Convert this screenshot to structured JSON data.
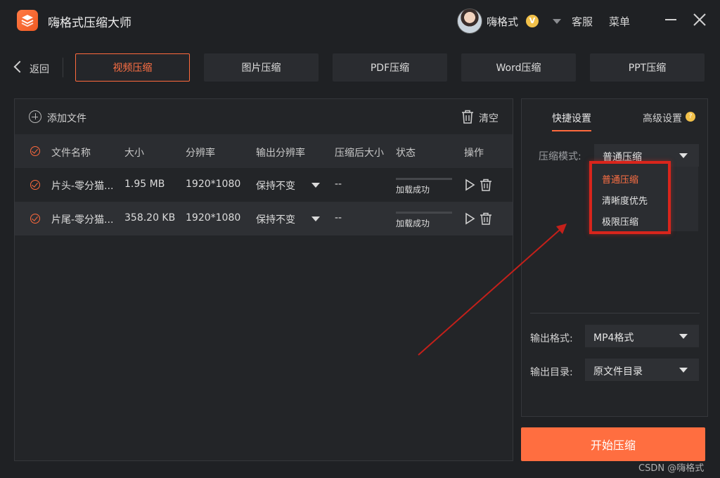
{
  "app": {
    "title": "嗨格式压缩大师"
  },
  "header": {
    "user_name": "嗨格式",
    "vip_badge": "V",
    "service_label": "客服",
    "menu_label": "菜单"
  },
  "nav": {
    "back_label": "返回",
    "tabs": [
      {
        "label": "视频压缩",
        "active": true
      },
      {
        "label": "图片压缩",
        "active": false
      },
      {
        "label": "PDF压缩",
        "active": false
      },
      {
        "label": "Word压缩",
        "active": false
      },
      {
        "label": "PPT压缩",
        "active": false
      }
    ]
  },
  "file_panel": {
    "add_file_label": "添加文件",
    "clear_label": "清空",
    "columns": [
      "文件名称",
      "大小",
      "分辨率",
      "输出分辨率",
      "压缩后大小",
      "状态",
      "操作"
    ],
    "rows": [
      {
        "name": "片头-零分猫...",
        "size": "1.95 MB",
        "resolution": "1920*1080",
        "output_resolution": "保持不变",
        "compressed_size": "--",
        "status": "加载成功"
      },
      {
        "name": "片尾-零分猫...",
        "size": "358.20 KB",
        "resolution": "1920*1080",
        "output_resolution": "保持不变",
        "compressed_size": "--",
        "status": "加载成功"
      }
    ]
  },
  "settings": {
    "tab_quick": "快捷设置",
    "tab_advanced": "高级设置",
    "help_badge": "?",
    "mode_label": "压缩模式:",
    "mode_value": "普通压缩",
    "mode_options": [
      "普通压缩",
      "清晰度优先",
      "极限压缩"
    ],
    "format_label": "输出格式:",
    "format_value": "MP4格式",
    "dir_label": "输出目录:",
    "dir_value": "原文件目录"
  },
  "start_button": "开始压缩",
  "watermark": "CSDN @嗨格式",
  "colors": {
    "accent": "#ff6e40",
    "annotation": "#d9251c",
    "background": "#1f2124"
  }
}
